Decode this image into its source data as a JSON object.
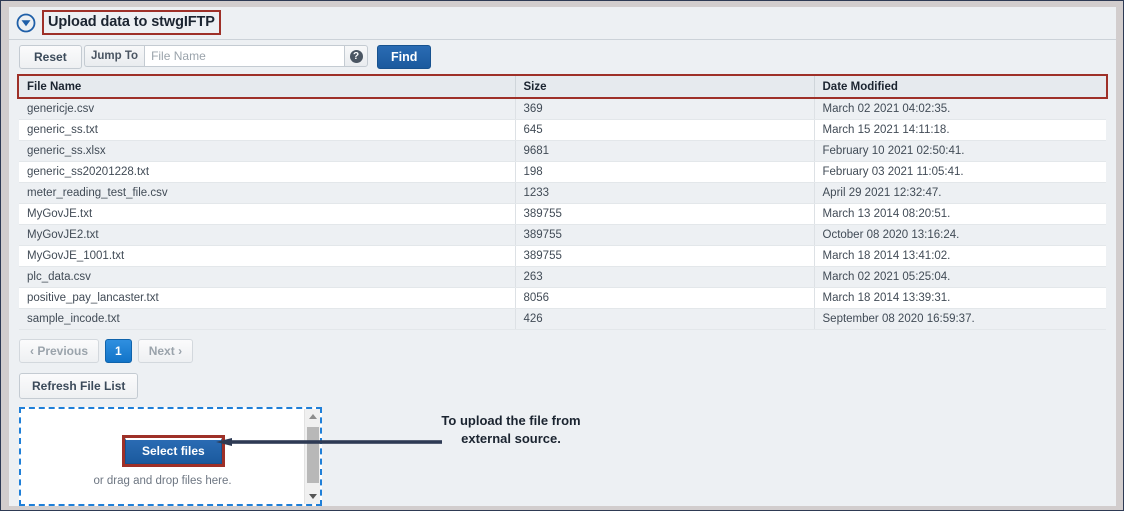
{
  "panel": {
    "title": "Upload data to stwgIFTP",
    "collapse_icon": "circle-triangle-down-icon"
  },
  "toolbar": {
    "reset_label": "Reset",
    "jump_to_label": "Jump To",
    "jump_to_value": "",
    "jump_to_placeholder": "File Name",
    "help_icon_label": "?",
    "find_label": "Find"
  },
  "table": {
    "columns": [
      "File Name",
      "Size",
      "Date Modified"
    ],
    "rows": [
      {
        "name": "genericje.csv",
        "size": "369",
        "date": "March 02 2021 04:02:35."
      },
      {
        "name": "generic_ss.txt",
        "size": "645",
        "date": "March 15 2021 14:11:18."
      },
      {
        "name": "generic_ss.xlsx",
        "size": "9681",
        "date": "February 10 2021 02:50:41."
      },
      {
        "name": "generic_ss20201228.txt",
        "size": "198",
        "date": "February 03 2021 11:05:41."
      },
      {
        "name": "meter_reading_test_file.csv",
        "size": "1233",
        "date": "April 29 2021 12:32:47."
      },
      {
        "name": "MyGovJE.txt",
        "size": "389755",
        "date": "March 13 2014 08:20:51."
      },
      {
        "name": "MyGovJE2.txt",
        "size": "389755",
        "date": "October 08 2020 13:16:24."
      },
      {
        "name": "MyGovJE_1001.txt",
        "size": "389755",
        "date": "March 18 2014 13:41:02."
      },
      {
        "name": "plc_data.csv",
        "size": "263",
        "date": "March 02 2021 05:25:04."
      },
      {
        "name": "positive_pay_lancaster.txt",
        "size": "8056",
        "date": "March 18 2014 13:39:31."
      },
      {
        "name": "sample_incode.txt",
        "size": "426",
        "date": "September 08 2020 16:59:37."
      }
    ]
  },
  "pagination": {
    "previous_label": "‹  Previous",
    "page_label": "1",
    "next_label": "Next  ›"
  },
  "actions": {
    "refresh_label": "Refresh File List"
  },
  "dropzone": {
    "select_files_label": "Select files",
    "hint": "or drag and drop files here.",
    "scroll_up_icon": "scroll-up-arrow-icon",
    "scroll_down_icon": "scroll-down-arrow-icon"
  },
  "annotation": {
    "text": "To upload the file from external source.",
    "arrow_icon": "left-pointing-arrow-icon"
  },
  "colors": {
    "highlight_red": "#9e3028",
    "primary_blue": "#1b5a9e",
    "page_active_blue": "#1274c8",
    "dropzone_dash": "#1f7fd8",
    "annotation_navy": "#2e3a54",
    "panel_bg": "#edf0f3"
  }
}
